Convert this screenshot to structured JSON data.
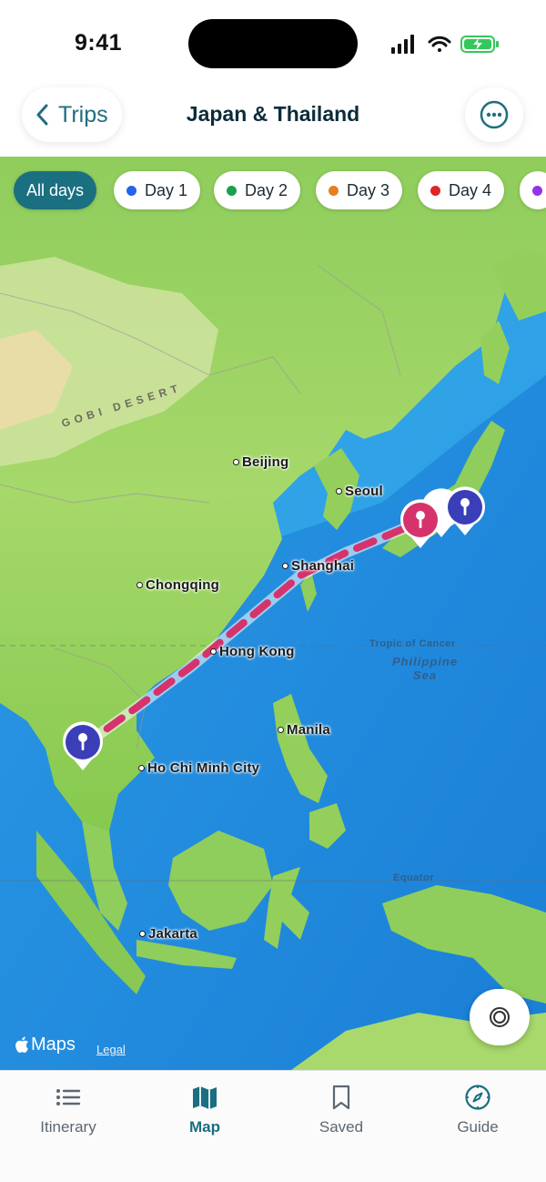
{
  "status_bar": {
    "time": "9:41"
  },
  "header": {
    "back_label": "Trips",
    "title": "Japan & Thailand"
  },
  "day_filters": [
    {
      "label": "All days",
      "active": true
    },
    {
      "label": "Day 1",
      "color": "#2563eb"
    },
    {
      "label": "Day 2",
      "color": "#16a34a"
    },
    {
      "label": "Day 3",
      "color": "#e67e22"
    },
    {
      "label": "Day 4",
      "color": "#dc2626"
    },
    {
      "label": "",
      "color": "#9333ea"
    }
  ],
  "map": {
    "cities": [
      "Beijing",
      "Seoul",
      "Shanghai",
      "Chongqing",
      "Hong Kong",
      "Manila",
      "Ho Chi Minh City",
      "Jakarta"
    ],
    "region_labels": {
      "desert": "GOBI DESERT",
      "sea": "Philippine\nSea",
      "tropic": "Tropic of Cancer",
      "equator": "Equator"
    },
    "route_color": "#d6336c",
    "attribution": {
      "logo": "Maps",
      "legal": "Legal"
    }
  },
  "tabs": [
    {
      "label": "Itinerary",
      "icon": "list-icon"
    },
    {
      "label": "Map",
      "icon": "map-icon",
      "active": true
    },
    {
      "label": "Saved",
      "icon": "bookmark-icon"
    },
    {
      "label": "Guide",
      "icon": "compass-icon"
    }
  ]
}
